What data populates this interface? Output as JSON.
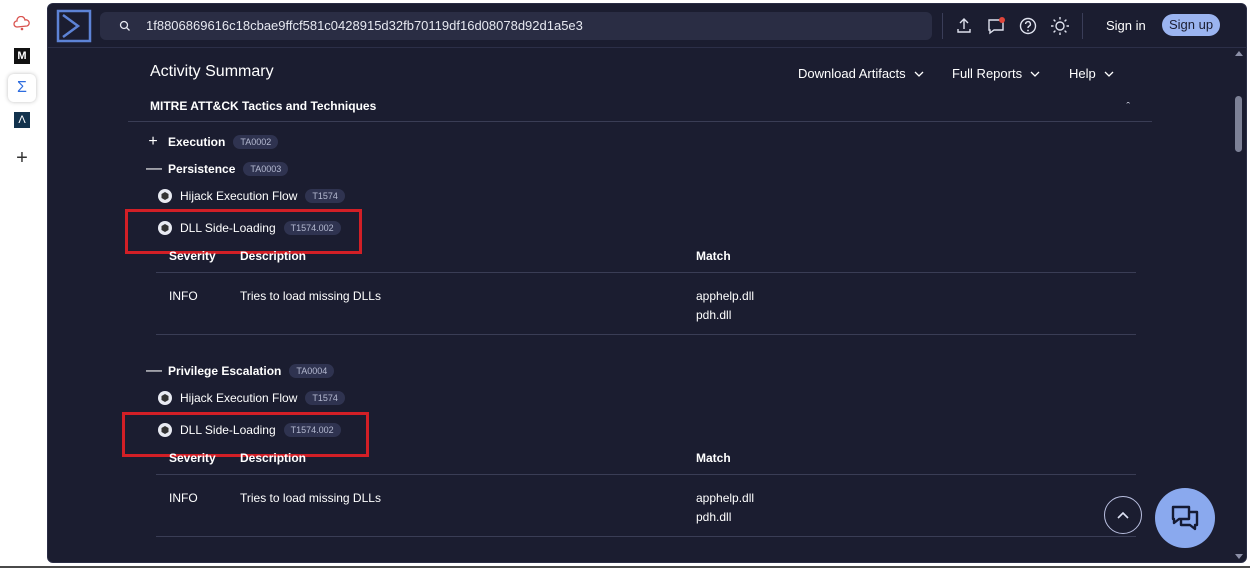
{
  "extensions": [
    {
      "icon": "cloud-icon",
      "label": ""
    },
    {
      "icon": "medium-logo-icon",
      "label": "M"
    },
    {
      "icon": "sigma-logo-icon",
      "label": "Σ"
    },
    {
      "icon": "lambda-logo-icon",
      "label": "Λ"
    },
    {
      "icon": "plus-icon",
      "label": "+"
    }
  ],
  "topbar": {
    "search_value": "1f8806869616c18cbae9ffcf581c0428915d32fb70119df16d08078d92d1a5e3",
    "signin_label": "Sign in",
    "signup_label": "Sign up"
  },
  "header": {
    "title": "Activity Summary",
    "menus": [
      "Download Artifacts",
      "Full Reports",
      "Help"
    ]
  },
  "section": {
    "title": "MITRE ATT&CK Tactics and Techniques",
    "collapse_glyph": "ˆ"
  },
  "tactics": [
    {
      "expander": "+",
      "name": "Execution",
      "id": "TA0002"
    },
    {
      "expander": "—",
      "name": "Persistence",
      "id": "TA0003"
    },
    {
      "expander": "—",
      "name": "Privilege Escalation",
      "id": "TA0004"
    }
  ],
  "techniques": [
    {
      "name": "Hijack Execution Flow",
      "id": "T1574"
    },
    {
      "name": "DLL Side-Loading",
      "id": "T1574.002"
    },
    {
      "name": "Hijack Execution Flow",
      "id": "T1574"
    },
    {
      "name": "DLL Side-Loading",
      "id": "T1574.002"
    }
  ],
  "table": {
    "headers": [
      "Severity",
      "Description",
      "Match"
    ],
    "rows": [
      {
        "severity": "INFO",
        "description": "Tries to load missing DLLs",
        "match": [
          "apphelp.dll",
          "pdh.dll"
        ]
      },
      {
        "severity": "INFO",
        "description": "Tries to load missing DLLs",
        "match": [
          "apphelp.dll",
          "pdh.dll"
        ]
      }
    ]
  },
  "colors": {
    "background": "#1b1d30",
    "accent": "#9bb4f0",
    "highlight": "#d21f26"
  }
}
